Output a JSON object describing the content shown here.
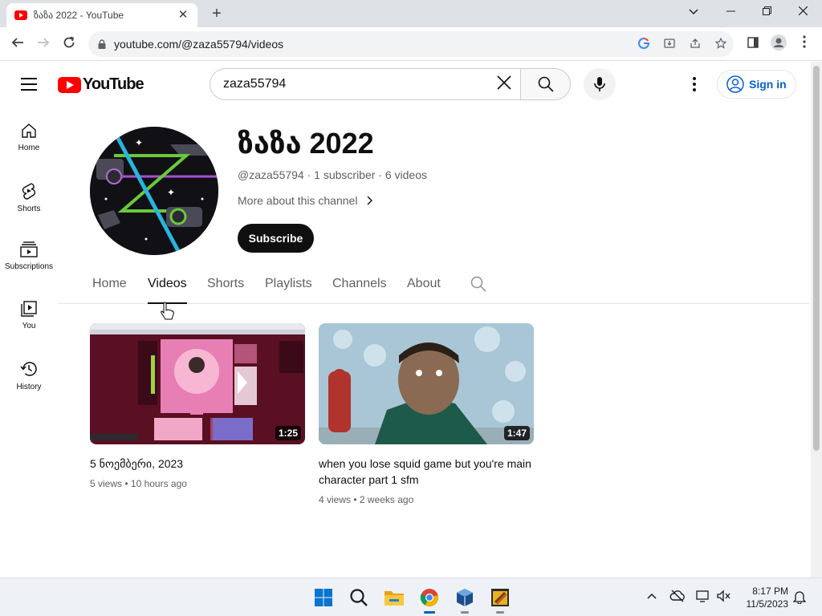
{
  "browser": {
    "tab_title": "ზაზა 2022 - YouTube",
    "tab_close": "✕",
    "new_tab": "+",
    "url": "youtube.com/@zaza55794/videos"
  },
  "masthead": {
    "logo_text": "YouTube",
    "search_value": "zaza55794",
    "search_clear": "✕",
    "signin_label": "Sign in"
  },
  "guide": {
    "items": [
      {
        "label": "Home",
        "icon": "home-icon"
      },
      {
        "label": "Shorts",
        "icon": "shorts-icon"
      },
      {
        "label": "Subscriptions",
        "icon": "subscriptions-icon"
      },
      {
        "label": "You",
        "icon": "you-icon"
      },
      {
        "label": "History",
        "icon": "history-icon"
      }
    ]
  },
  "channel": {
    "name": "ზაზა 2022",
    "meta": "@zaza55794 · 1 subscriber · 6 videos",
    "more_about": "More about this channel",
    "subscribe_label": "Subscribe",
    "tabs": [
      "Home",
      "Videos",
      "Shorts",
      "Playlists",
      "Channels",
      "About"
    ],
    "active_tab": "Videos"
  },
  "videos": [
    {
      "title": "5 ნოემბერი, 2023",
      "views": "5 views",
      "age": "10 hours ago",
      "duration": "1:25"
    },
    {
      "title": "when you lose squid game but you're main character part 1 sfm",
      "views": "4 views",
      "age": "2 weeks ago",
      "duration": "1:47"
    }
  ],
  "taskbar": {
    "time": "8:17 PM",
    "date": "11/5/2023"
  },
  "colors": {
    "youtube_red": "#ff0000",
    "signin_blue": "#065fd4",
    "subscribe_bg": "#0f0f0f"
  }
}
